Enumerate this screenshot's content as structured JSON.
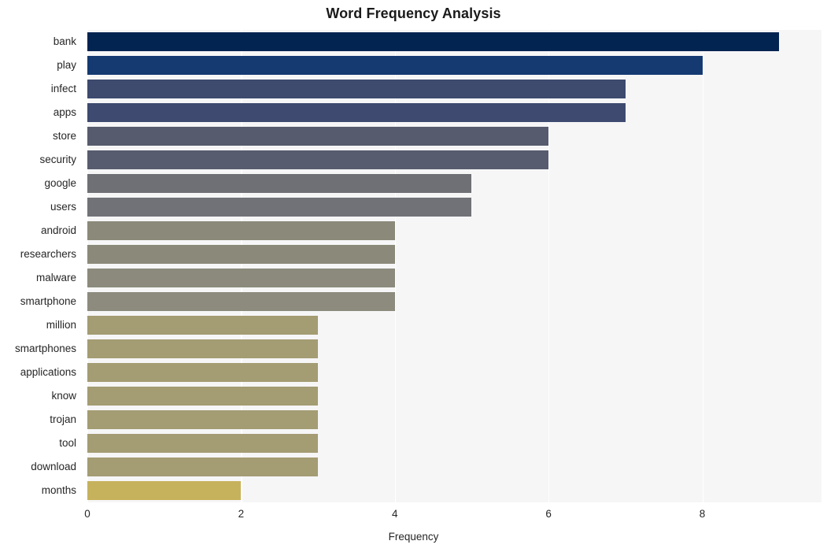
{
  "chart_data": {
    "type": "bar",
    "orientation": "horizontal",
    "title": "Word Frequency Analysis",
    "xlabel": "Frequency",
    "ylabel": "",
    "categories": [
      "bank",
      "play",
      "infect",
      "apps",
      "store",
      "security",
      "google",
      "users",
      "android",
      "researchers",
      "malware",
      "smartphone",
      "million",
      "smartphones",
      "applications",
      "know",
      "trojan",
      "tool",
      "download",
      "months"
    ],
    "values": [
      9,
      8,
      7,
      7,
      6,
      6,
      5,
      5,
      4,
      4,
      4,
      4,
      3,
      3,
      3,
      3,
      3,
      3,
      3,
      2
    ],
    "bar_colors": [
      "#022451",
      "#153a72",
      "#3e4a6e",
      "#3e4a70",
      "#565b6d",
      "#575c6e",
      "#6e7076",
      "#717278",
      "#8b8979",
      "#8b8979",
      "#8b8a7c",
      "#8d8b7e",
      "#a49c73",
      "#a49c73",
      "#a49c73",
      "#a49c73",
      "#a49c73",
      "#a49c73",
      "#a49c73",
      "#c6b25c"
    ],
    "xticks": [
      0,
      2,
      4,
      6,
      8
    ],
    "xtick_labels": [
      "0",
      "2",
      "4",
      "6",
      "8"
    ],
    "xlim": [
      0,
      9.55
    ],
    "grid": true,
    "grid_axis": "x",
    "grid_color": "#ffffff",
    "plot_background": "#f6f6f7",
    "figure_background": "#ffffff",
    "tick_color": "#262626",
    "title_color": "#1a1a1a"
  }
}
